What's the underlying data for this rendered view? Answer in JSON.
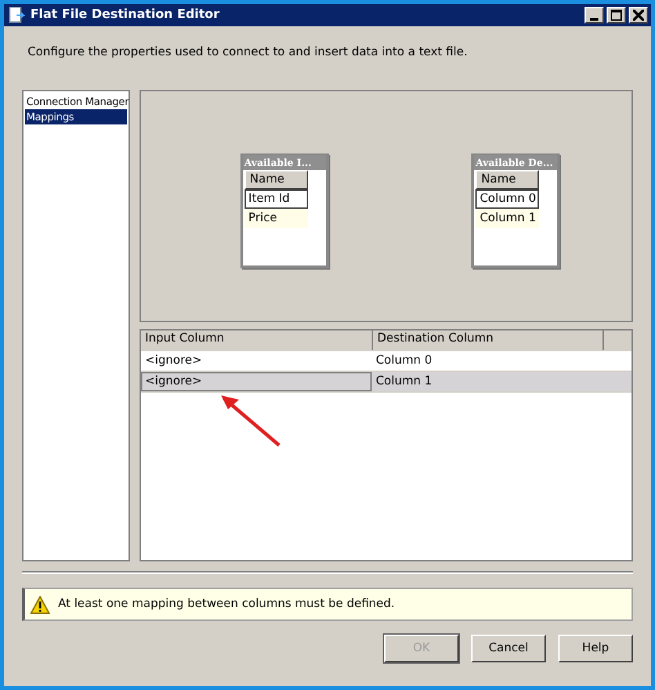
{
  "window": {
    "title": "Flat File Destination Editor"
  },
  "description": "Configure the properties used to connect to and insert data into a text file.",
  "sidebar": {
    "items": [
      {
        "label": "Connection Manager",
        "selected": false
      },
      {
        "label": "Mappings",
        "selected": true
      }
    ]
  },
  "available_tables": [
    {
      "title": "Available I...",
      "header": "Name",
      "rows": [
        {
          "label": "Item Id",
          "selected": true
        },
        {
          "label": "Price",
          "selected": false
        }
      ]
    },
    {
      "title": "Available De...",
      "header": "Name",
      "rows": [
        {
          "label": "Column 0",
          "selected": true
        },
        {
          "label": "Column 1",
          "selected": false
        }
      ]
    }
  ],
  "mapping_grid": {
    "columns": [
      "Input Column",
      "Destination Column"
    ],
    "rows": [
      {
        "cells": [
          "<ignore>",
          "Column 0"
        ],
        "selected": false
      },
      {
        "cells": [
          "<ignore>",
          "Column 1"
        ],
        "selected": true
      }
    ]
  },
  "warning": "At least one mapping between columns must be defined.",
  "buttons": [
    {
      "label": "OK",
      "disabled": true
    },
    {
      "label": "Cancel",
      "disabled": false
    },
    {
      "label": "Help",
      "disabled": false
    }
  ]
}
